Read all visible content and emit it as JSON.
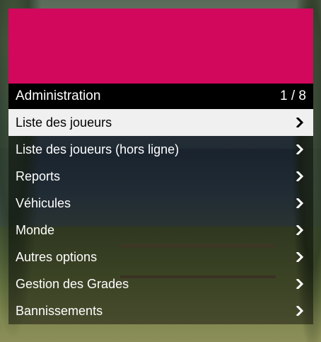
{
  "menu": {
    "banner_color": "#d1085c",
    "title": "Administration",
    "counter": "1 / 8",
    "items": [
      {
        "label": "Liste des joueurs",
        "icon": "chevron-right-icon"
      },
      {
        "label": "Liste des joueurs (hors ligne)",
        "icon": "chevron-right-icon"
      },
      {
        "label": "Reports",
        "icon": "chevron-right-icon"
      },
      {
        "label": "Véhicules",
        "icon": "chevron-right-icon"
      },
      {
        "label": "Monde",
        "icon": "chevron-right-icon"
      },
      {
        "label": "Autres options",
        "icon": "chevron-right-icon"
      },
      {
        "label": "Gestion des Grades",
        "icon": "chevron-right-icon"
      },
      {
        "label": "Bannissements",
        "icon": "chevron-right-icon"
      }
    ],
    "selected_index": 0
  }
}
